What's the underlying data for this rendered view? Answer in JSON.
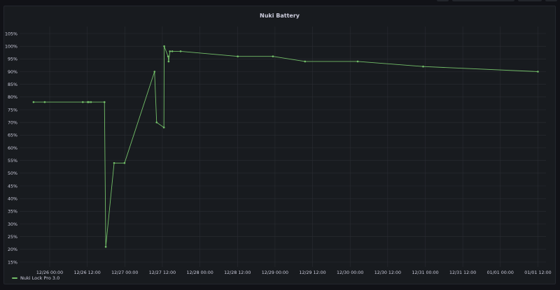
{
  "panel": {
    "title": "Nuki Battery"
  },
  "chart_data": {
    "type": "line",
    "title": "Nuki Battery",
    "xlabel": "",
    "ylabel": "",
    "ylim": [
      15,
      105
    ],
    "yticks": [
      "15%",
      "20%",
      "25%",
      "30%",
      "35%",
      "40%",
      "45%",
      "50%",
      "55%",
      "60%",
      "65%",
      "70%",
      "75%",
      "80%",
      "85%",
      "90%",
      "95%",
      "100%",
      "105%"
    ],
    "xticks": [
      "12/26 00:00",
      "12/26 12:00",
      "12/27 00:00",
      "12/27 12:00",
      "12/28 00:00",
      "12/28 12:00",
      "12/29 00:00",
      "12/29 12:00",
      "12/30 00:00",
      "12/30 12:00",
      "12/31 00:00",
      "12/31 12:00",
      "01/01 00:00",
      "01/01 12:00"
    ],
    "grid": true,
    "legend_position": "bottom-left",
    "series": [
      {
        "name": "Nuki Lock Pro 3.0",
        "color": "#73bf69",
        "points": [
          [
            "12/25 18:50",
            78
          ],
          [
            "12/25 22:25",
            78
          ],
          [
            "12/26 10:35",
            78
          ],
          [
            "12/26 12:10",
            78
          ],
          [
            "12/26 12:30",
            78
          ],
          [
            "12/26 13:10",
            78
          ],
          [
            "12/26 17:30",
            78
          ],
          [
            "12/26 17:55",
            21
          ],
          [
            "12/26 20:35",
            54
          ],
          [
            "12/26 23:55",
            54
          ],
          [
            "12/27 09:30",
            90
          ],
          [
            "12/27 10:10",
            70
          ],
          [
            "12/27 12:30",
            68
          ],
          [
            "12/27 12:35",
            100
          ],
          [
            "12/27 13:50",
            96
          ],
          [
            "12/27 14:00",
            94
          ],
          [
            "12/27 14:25",
            98
          ],
          [
            "12/27 15:10",
            98
          ],
          [
            "12/27 17:50",
            98
          ],
          [
            "12/28 12:05",
            96
          ],
          [
            "12/28 23:20",
            96
          ],
          [
            "12/29 09:35",
            94
          ],
          [
            "12/30 02:25",
            94
          ],
          [
            "12/30 23:20",
            92
          ],
          [
            "01/01 12:00",
            90
          ]
        ]
      }
    ]
  }
}
